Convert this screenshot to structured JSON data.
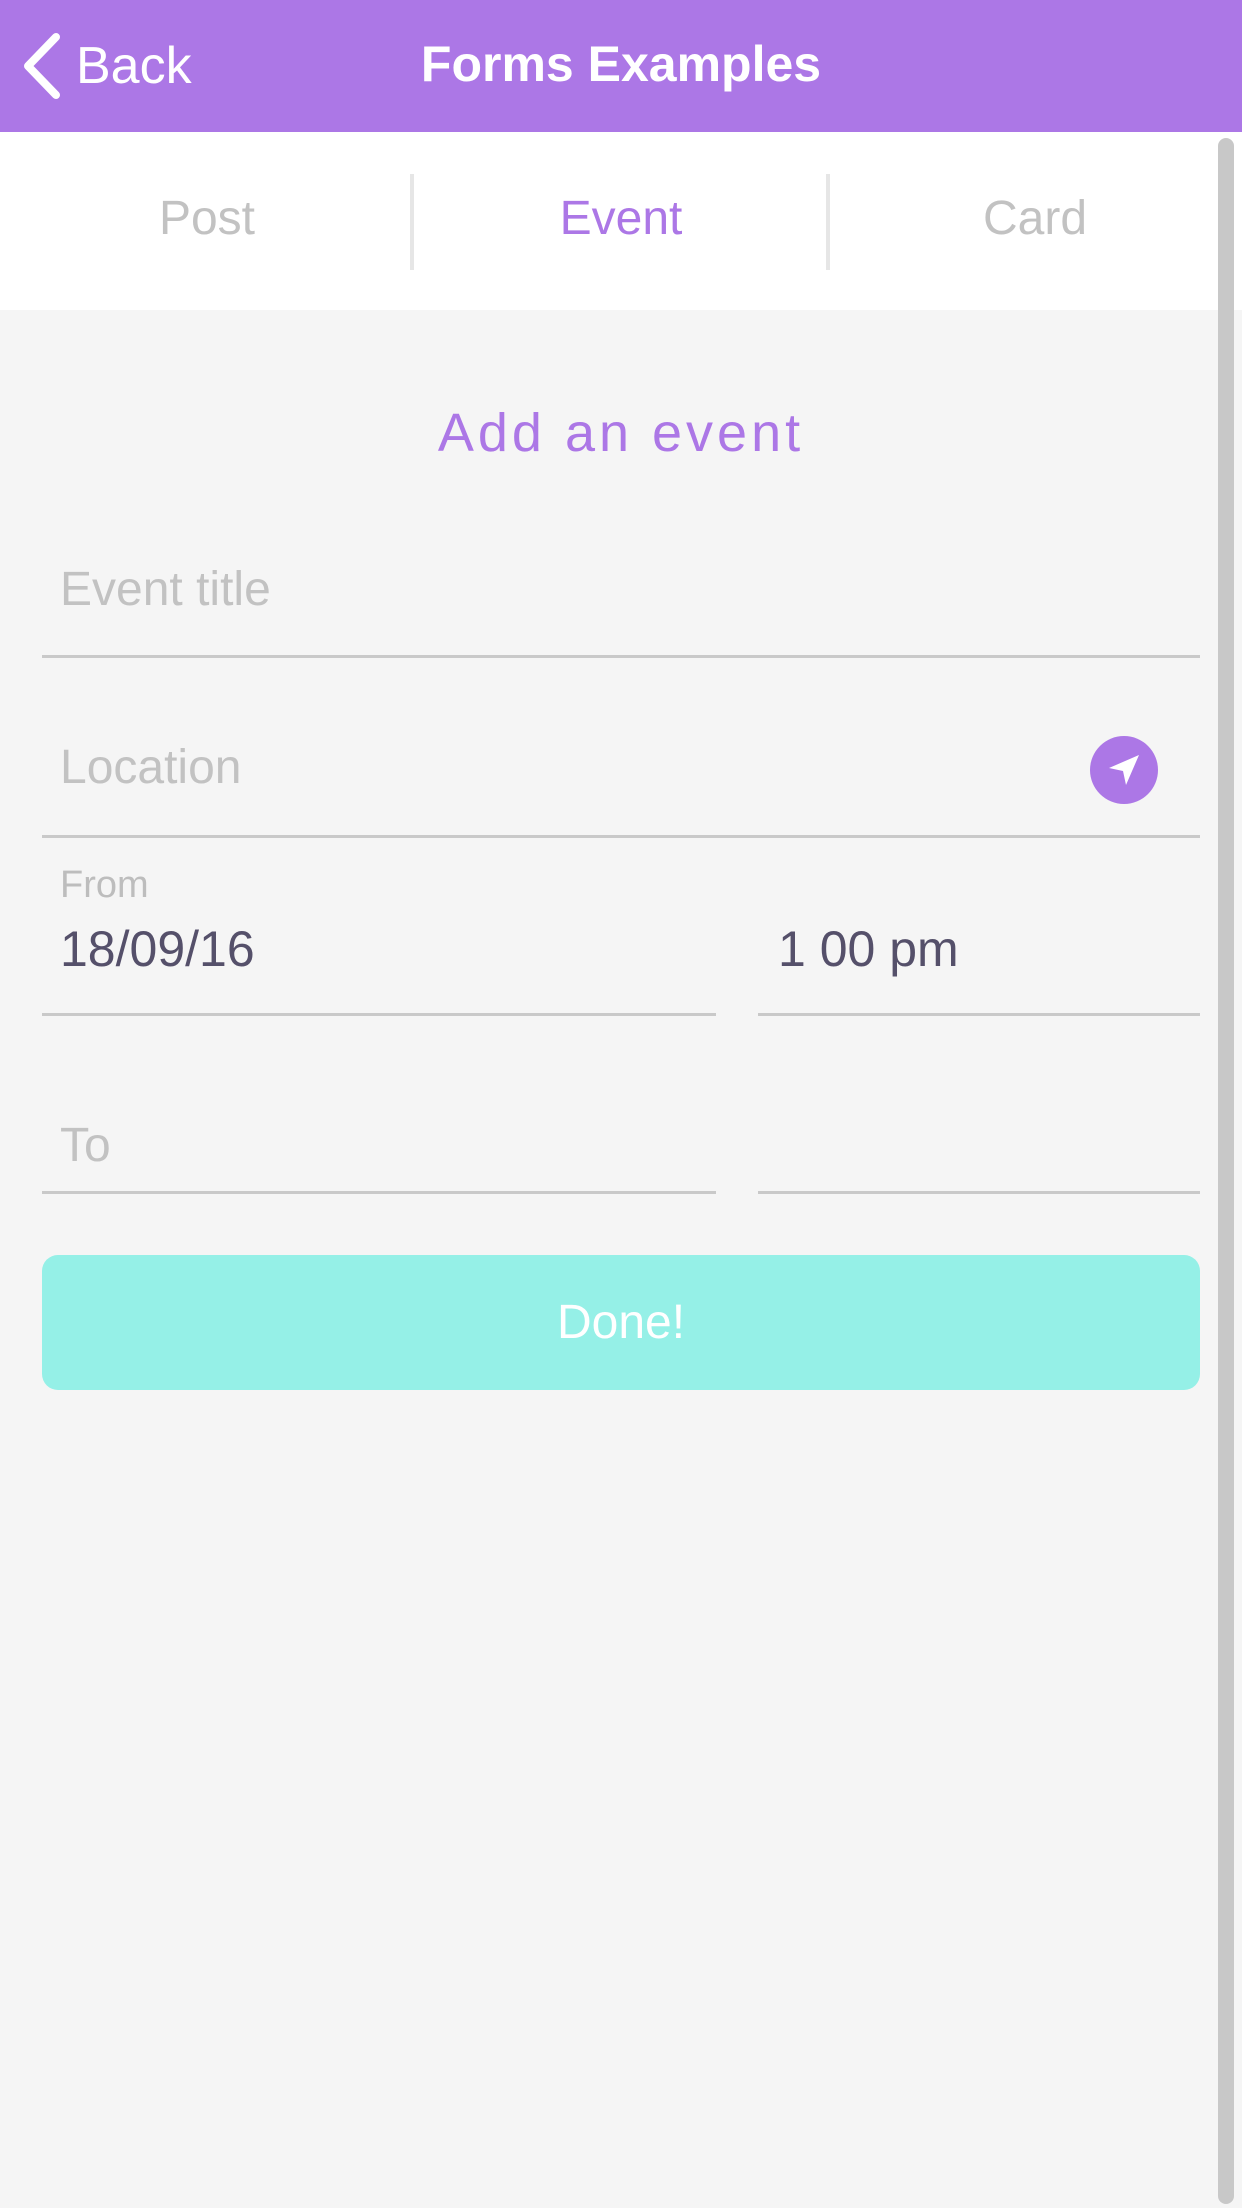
{
  "navbar": {
    "back_label": "Back",
    "title": "Forms Examples"
  },
  "tabs": [
    {
      "label": "Post",
      "active": false
    },
    {
      "label": "Event",
      "active": true
    },
    {
      "label": "Card",
      "active": false
    }
  ],
  "form": {
    "title": "Add an event",
    "event_title": {
      "placeholder": "Event title",
      "value": ""
    },
    "location": {
      "placeholder": "Location",
      "value": "",
      "icon": "navigation-arrow-icon"
    },
    "from": {
      "label": "From",
      "date": "18/09/16",
      "time": "1 00 pm"
    },
    "to": {
      "placeholder": "To",
      "date": "",
      "time": ""
    },
    "done_label": "Done!"
  },
  "colors": {
    "accent": "#ac77e6",
    "done_button": "#95f0e7",
    "background": "#f5f5f5",
    "placeholder": "#c2c2c2",
    "value_text": "#55506a"
  }
}
